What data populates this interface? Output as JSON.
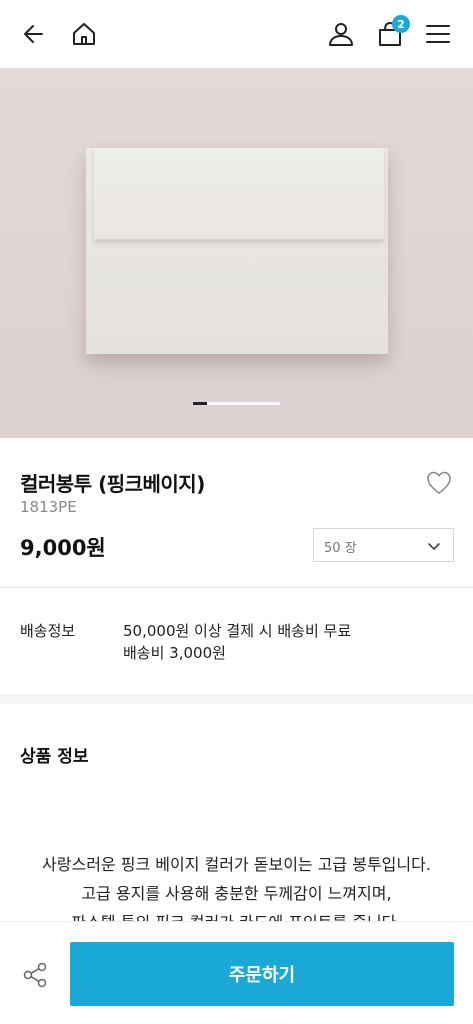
{
  "header": {
    "back_icon": "arrow-left-icon",
    "home_icon": "home-icon",
    "user_icon": "user-icon",
    "cart_icon": "shopping-bag-icon",
    "cart_count": "2",
    "menu_icon": "hamburger-menu-icon"
  },
  "gallery": {
    "slide_count": 6,
    "current_slide": 1
  },
  "product": {
    "name": "컬러봉투 (핑크베이지)",
    "code": "1813PE",
    "price": "9,000원",
    "quantity_selected": "50 장",
    "wishlist_icon": "heart-outline-icon"
  },
  "shipping": {
    "label": "배송정보",
    "line1": "50,000원 이상 결제 시 배송비 무료",
    "line2": "배송비 3,000원"
  },
  "details": {
    "title": "상품 정보",
    "lines": [
      "사랑스러운 핑크 베이지 컬러가 돋보이는 고급 봉투입니다.",
      "고급 용지를 사용해 충분한 두께감이 느껴지며,",
      "파스텔 톤의 핑크 컬러가 카드에 포인트를 줍니다."
    ]
  },
  "bottom": {
    "share_icon": "share-icon",
    "order_label": "주문하기"
  },
  "colors": {
    "accent": "#1aa9d6",
    "hero_bg": "#dfd5d4"
  }
}
